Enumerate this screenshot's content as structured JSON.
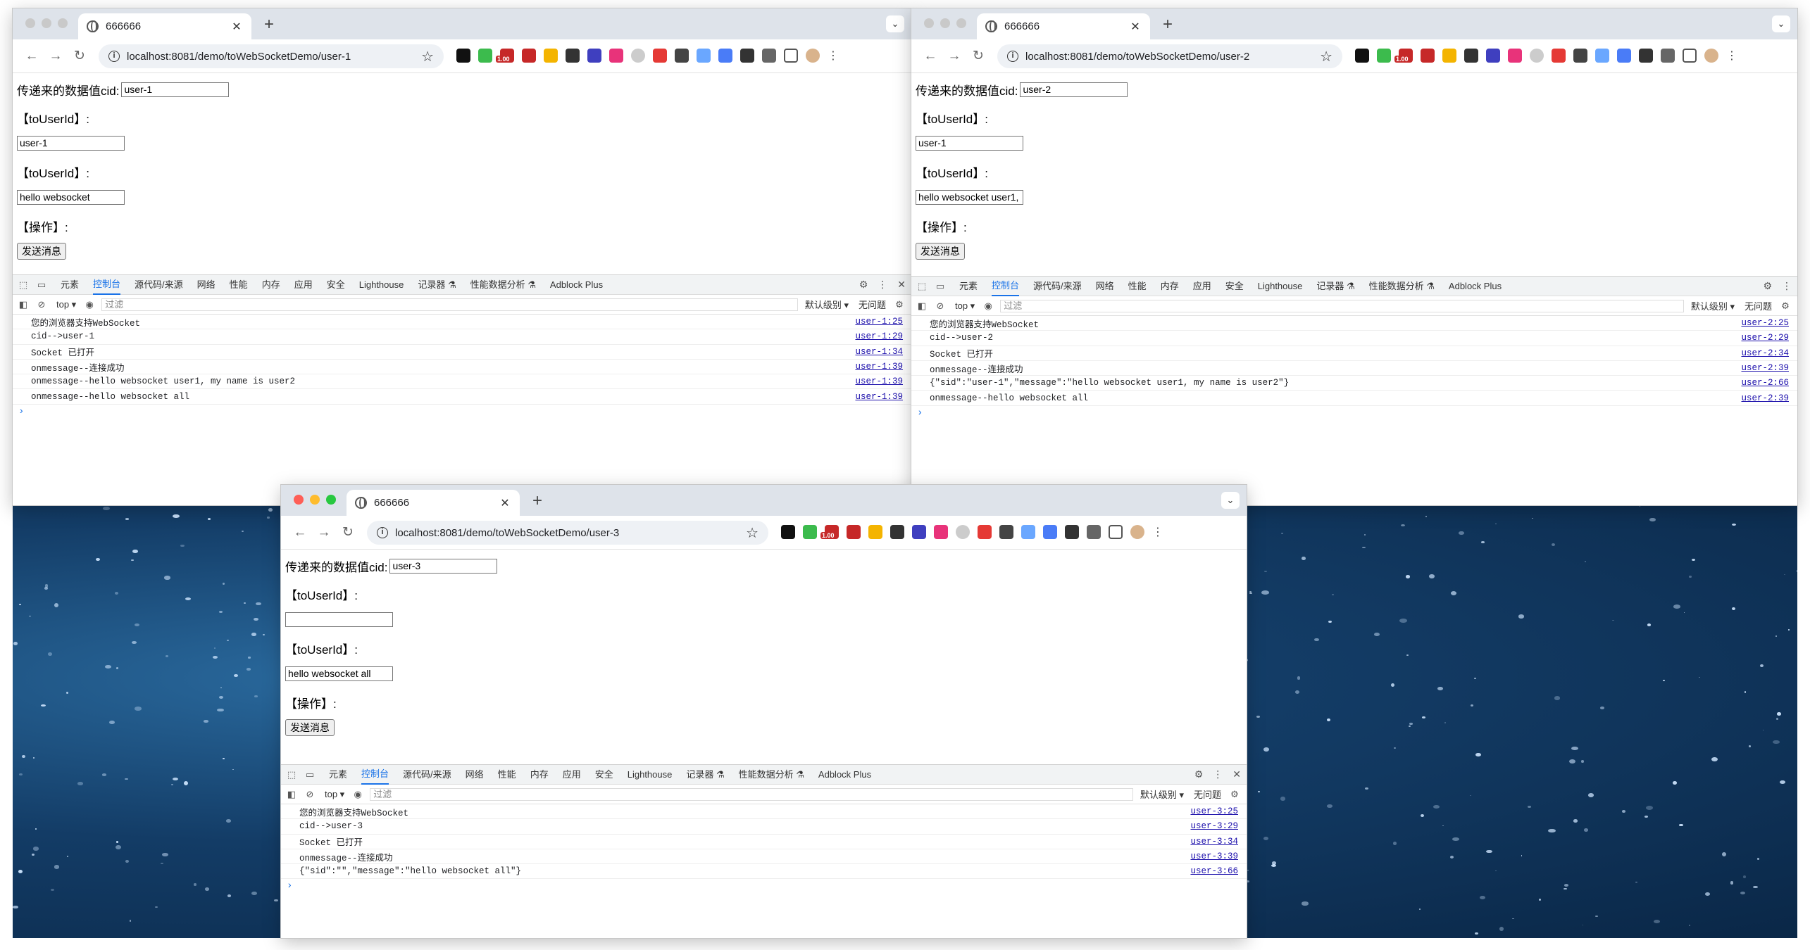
{
  "windows": [
    {
      "id": "w1",
      "tab_title": "666666",
      "url": "localhost:8081/demo/toWebSocketDemo/user-1",
      "cid_label": "传递来的数据值cid:",
      "cid_value": "user-1",
      "to_user_label": "【toUserId】:",
      "to_user_value": "user-1",
      "message_label": "【toUserId】:",
      "message_value": "hello websocket",
      "action_label": "【操作】:",
      "send_button": "发送消息",
      "logs": [
        {
          "msg": "您的浏览器支持WebSocket",
          "src": "user-1:25"
        },
        {
          "msg": "cid-->user-1",
          "src": "user-1:29"
        },
        {
          "msg": "Socket 已打开",
          "src": "user-1:34"
        },
        {
          "msg": "onmessage--连接成功",
          "src": "user-1:39"
        },
        {
          "msg": "onmessage--hello websocket user1, my name is user2",
          "src": "user-1:39"
        },
        {
          "msg": "onmessage--hello websocket all",
          "src": "user-1:39"
        }
      ]
    },
    {
      "id": "w2",
      "tab_title": "666666",
      "url": "localhost:8081/demo/toWebSocketDemo/user-2",
      "cid_label": "传递来的数据值cid:",
      "cid_value": "user-2",
      "to_user_label": "【toUserId】:",
      "to_user_value": "user-1",
      "message_label": "【toUserId】:",
      "message_value": "hello websocket user1,",
      "action_label": "【操作】:",
      "send_button": "发送消息",
      "logs": [
        {
          "msg": "您的浏览器支持WebSocket",
          "src": "user-2:25"
        },
        {
          "msg": "cid-->user-2",
          "src": "user-2:29"
        },
        {
          "msg": "Socket 已打开",
          "src": "user-2:34"
        },
        {
          "msg": "onmessage--连接成功",
          "src": "user-2:39"
        },
        {
          "msg": "{\"sid\":\"user-1\",\"message\":\"hello websocket user1, my name is user2\"}",
          "src": "user-2:66"
        },
        {
          "msg": "onmessage--hello websocket all",
          "src": "user-2:39"
        }
      ]
    },
    {
      "id": "w3",
      "tab_title": "666666",
      "url": "localhost:8081/demo/toWebSocketDemo/user-3",
      "cid_label": "传递来的数据值cid:",
      "cid_value": "user-3",
      "to_user_label": "【toUserId】:",
      "to_user_value": "",
      "message_label": "【toUserId】:",
      "message_value": "hello websocket all",
      "action_label": "【操作】:",
      "send_button": "发送消息",
      "logs": [
        {
          "msg": "您的浏览器支持WebSocket",
          "src": "user-3:25"
        },
        {
          "msg": "cid-->user-3",
          "src": "user-3:29"
        },
        {
          "msg": "Socket 已打开",
          "src": "user-3:34"
        },
        {
          "msg": "onmessage--连接成功",
          "src": "user-3:39"
        },
        {
          "msg": "{\"sid\":\"\",\"message\":\"hello websocket all\"}",
          "src": "user-3:66"
        }
      ]
    }
  ],
  "devtools": {
    "tabs": [
      "元素",
      "控制台",
      "源代码/来源",
      "网络",
      "性能",
      "内存",
      "应用",
      "安全",
      "Lighthouse",
      "记录器 ⚗",
      "性能数据分析 ⚗",
      "Adblock Plus"
    ],
    "active_tab": "控制台",
    "context": "top ▾",
    "filter_placeholder": "过滤",
    "level": "默认级别 ▾",
    "issues": "无问题",
    "prompt": "›"
  },
  "extension_icons": [
    "notion-icon",
    "puzzle-green-icon",
    "tag-badge-icon",
    "pdf-icon",
    "chrome-color-icon",
    "pilcrow-icon",
    "hexagon-icon",
    "translate-icon",
    "ghost-icon",
    "adblock-icon",
    "vpn-icon",
    "screen-icon",
    "blue-square-icon",
    "camera-icon",
    "extensions-icon"
  ],
  "colors": {
    "active_tab": "#1a73e8",
    "tabstrip": "#dee3ea",
    "link": "#1a0dab"
  }
}
